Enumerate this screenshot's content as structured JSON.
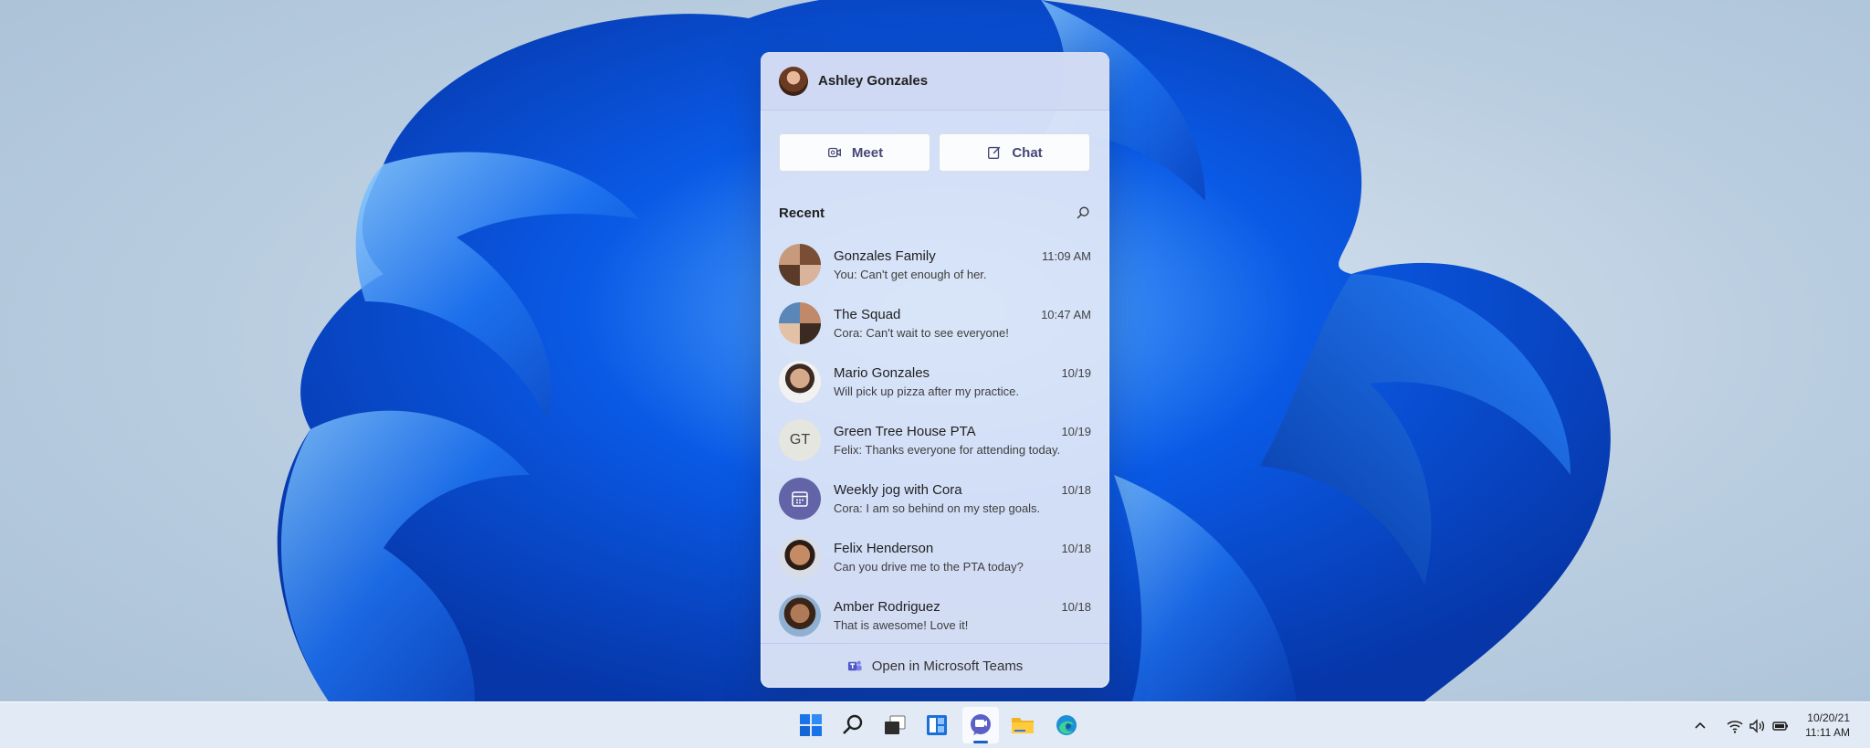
{
  "flyout": {
    "user_name": "Ashley Gonzales",
    "meet_label": "Meet",
    "chat_label": "Chat",
    "recent_label": "Recent",
    "footer_label": "Open in Microsoft Teams",
    "chats": [
      {
        "name": "Gonzales Family",
        "time": "11:09 AM",
        "preview": "You: Can't get enough of her.",
        "avatar": "group-photo"
      },
      {
        "name": "The Squad",
        "time": "10:47 AM",
        "preview": "Cora: Can't wait to see everyone!",
        "avatar": "group-photo"
      },
      {
        "name": "Mario Gonzales",
        "time": "10/19",
        "preview": "Will pick up pizza after my practice.",
        "avatar": "photo"
      },
      {
        "name": "Green Tree House PTA",
        "time": "10/19",
        "preview": "Felix: Thanks everyone for attending today.",
        "avatar": "GT"
      },
      {
        "name": "Weekly jog with Cora",
        "time": "10/18",
        "preview": "Cora: I am so behind on my step goals.",
        "avatar": "calendar-icon"
      },
      {
        "name": "Felix Henderson",
        "time": "10/18",
        "preview": "Can you drive me to the PTA today?",
        "avatar": "photo"
      },
      {
        "name": "Amber Rodriguez",
        "time": "10/18",
        "preview": "That is awesome! Love it!",
        "avatar": "photo"
      }
    ]
  },
  "taskbar": {
    "apps": [
      "start-icon",
      "search-icon",
      "task-view-icon",
      "widgets-icon",
      "teams-chat-icon",
      "file-explorer-icon",
      "edge-icon"
    ],
    "active_app": "teams-chat-icon",
    "tray": [
      "chevron-up-icon",
      "wifi-icon",
      "volume-icon",
      "battery-icon"
    ],
    "date": "10/20/21",
    "time": "11:11 AM"
  },
  "colors": {
    "teams_purple": "#6264a7",
    "accent_blue": "#1b5fc4"
  }
}
